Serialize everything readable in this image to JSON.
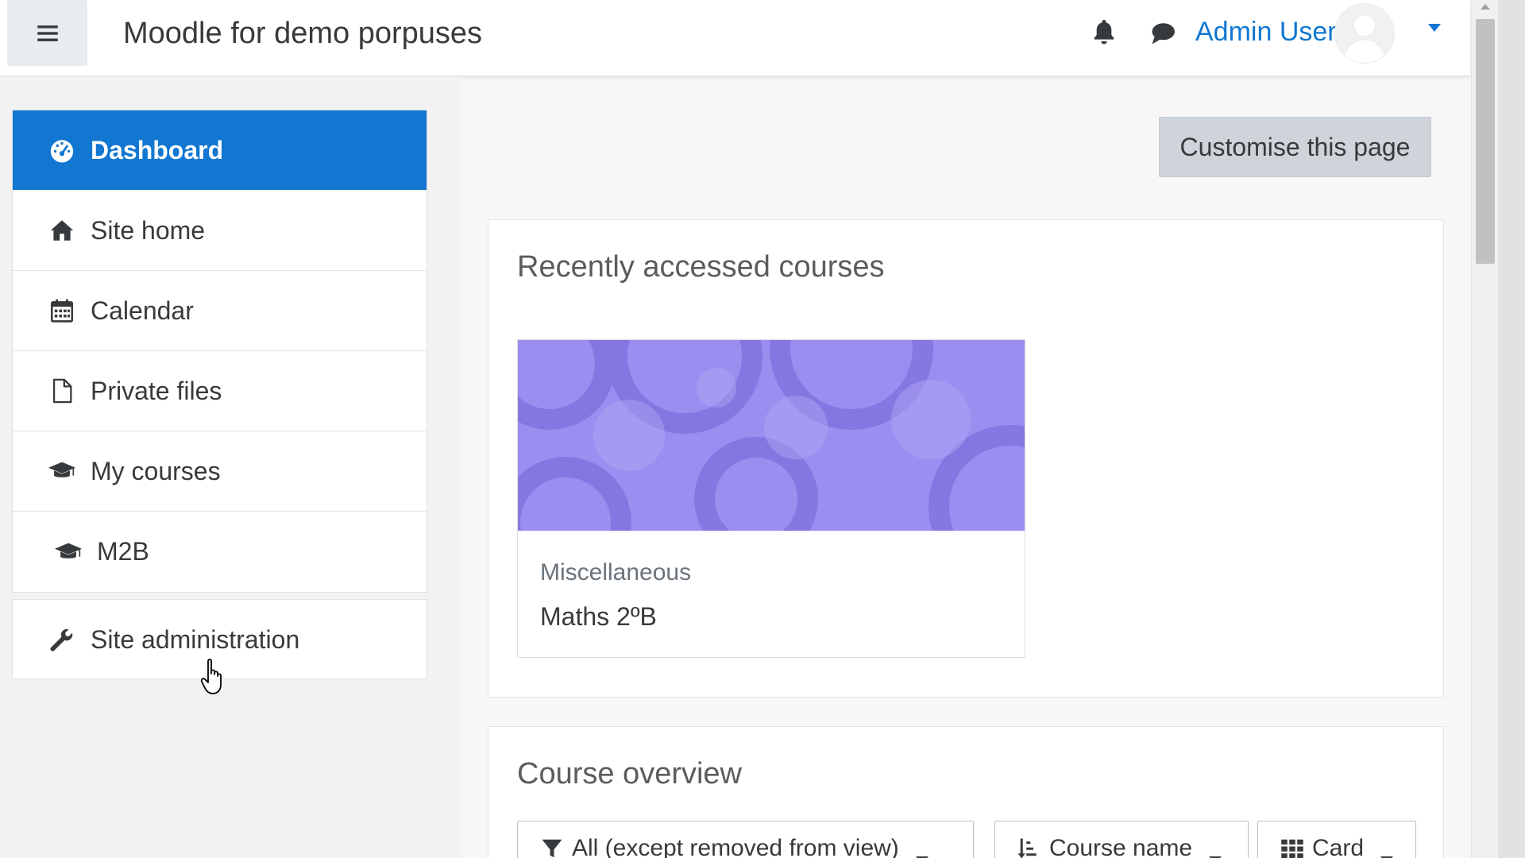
{
  "navbar": {
    "site_name": "Moodle for demo porpuses",
    "user_name": "Admin User"
  },
  "nav": {
    "items": [
      {
        "label": "Dashboard",
        "icon": "dashboard-icon",
        "active": true
      },
      {
        "label": "Site home",
        "icon": "home-icon"
      },
      {
        "label": "Calendar",
        "icon": "calendar-icon"
      },
      {
        "label": "Private files",
        "icon": "file-icon"
      },
      {
        "label": "My courses",
        "icon": "graduation-cap-icon"
      },
      {
        "label": "M2B",
        "icon": "graduation-cap-icon"
      }
    ],
    "admin_label": "Site administration"
  },
  "main": {
    "customise_label": "Customise this page",
    "recent": {
      "title": "Recently accessed courses",
      "course": {
        "category": "Miscellaneous",
        "name": "Maths 2ºB"
      }
    },
    "overview": {
      "title": "Course overview",
      "filter_label": "All (except removed from view)",
      "sort_label": "Course name",
      "view_label": "Card"
    }
  },
  "colors": {
    "accent": "#1177d1",
    "course_image": "#9a8ff0"
  }
}
